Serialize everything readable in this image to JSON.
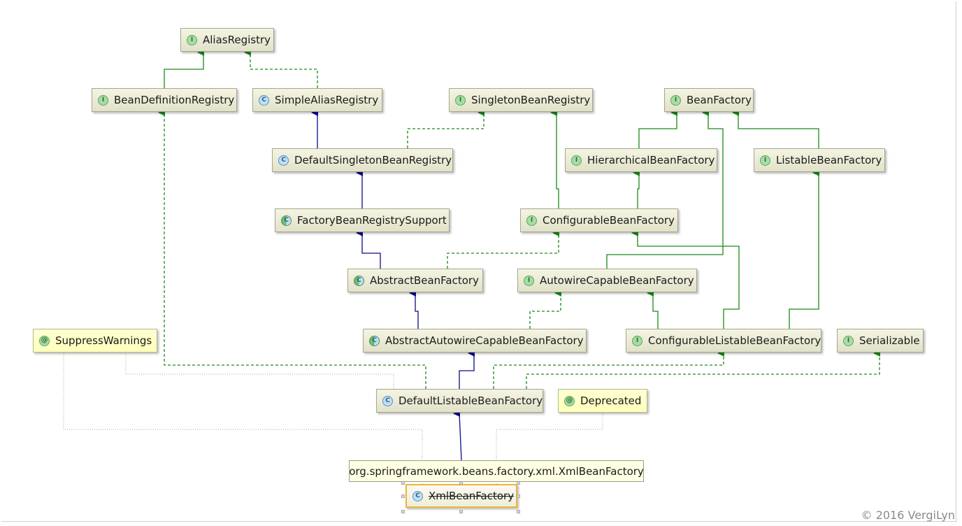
{
  "nodes": [
    {
      "id": "alias_registry",
      "label": "AliasRegistry",
      "kind": "interface",
      "icon": "interface-icon"
    },
    {
      "id": "bean_definition_registry",
      "label": "BeanDefinitionRegistry",
      "kind": "interface",
      "icon": "interface-icon"
    },
    {
      "id": "simple_alias_registry",
      "label": "SimpleAliasRegistry",
      "kind": "class",
      "icon": "class-icon"
    },
    {
      "id": "singleton_bean_registry",
      "label": "SingletonBeanRegistry",
      "kind": "interface",
      "icon": "interface-icon"
    },
    {
      "id": "bean_factory",
      "label": "BeanFactory",
      "kind": "interface",
      "icon": "interface-icon"
    },
    {
      "id": "default_singleton_bean_registry",
      "label": "DefaultSingletonBeanRegistry",
      "kind": "class",
      "icon": "class-icon"
    },
    {
      "id": "hierarchical_bean_factory",
      "label": "HierarchicalBeanFactory",
      "kind": "interface",
      "icon": "interface-icon"
    },
    {
      "id": "listable_bean_factory",
      "label": "ListableBeanFactory",
      "kind": "interface",
      "icon": "interface-icon"
    },
    {
      "id": "factory_bean_registry_support",
      "label": "FactoryBeanRegistrySupport",
      "kind": "abstract",
      "icon": "abstract-class-icon"
    },
    {
      "id": "configurable_bean_factory",
      "label": "ConfigurableBeanFactory",
      "kind": "interface",
      "icon": "interface-icon"
    },
    {
      "id": "abstract_bean_factory",
      "label": "AbstractBeanFactory",
      "kind": "abstract",
      "icon": "abstract-class-icon"
    },
    {
      "id": "autowire_capable_bean_factory",
      "label": "AutowireCapableBeanFactory",
      "kind": "interface",
      "icon": "interface-icon"
    },
    {
      "id": "suppress_warnings",
      "label": "SuppressWarnings",
      "kind": "annotation",
      "icon": "annotation-icon"
    },
    {
      "id": "abstract_autowire_capable_bean_factory",
      "label": "AbstractAutowireCapableBeanFactory",
      "kind": "abstract",
      "icon": "abstract-class-icon"
    },
    {
      "id": "configurable_listable_bean_factory",
      "label": "ConfigurableListableBeanFactory",
      "kind": "interface",
      "icon": "interface-icon"
    },
    {
      "id": "serializable",
      "label": "Serializable",
      "kind": "interface",
      "icon": "interface-icon"
    },
    {
      "id": "default_listable_bean_factory",
      "label": "DefaultListableBeanFactory",
      "kind": "class",
      "icon": "class-icon"
    },
    {
      "id": "deprecated",
      "label": "Deprecated",
      "kind": "annotation",
      "icon": "annotation-icon"
    },
    {
      "id": "xml_bean_factory",
      "label": "XmlBeanFactory",
      "kind": "class",
      "icon": "class-icon",
      "deprecated": true,
      "selected": true
    }
  ],
  "badges": {
    "interface": "I",
    "class": "C",
    "abstract": "C",
    "annotation": "@"
  },
  "tooltip": "org.springframework.beans.factory.xml.XmlBeanFactory",
  "copyright": "© 2016 VergiLyn",
  "colors": {
    "extends_class": "#0a0a8a",
    "extends_interface": "#1a8a1a",
    "implements": "#1a8a1a",
    "annotation_link": "#b8b8b8",
    "selection": "#f2b33d"
  },
  "edges": [
    {
      "from": "bean_definition_registry",
      "to": "alias_registry",
      "type": "interface-extends"
    },
    {
      "from": "simple_alias_registry",
      "to": "alias_registry",
      "type": "implements"
    },
    {
      "from": "default_singleton_bean_registry",
      "to": "simple_alias_registry",
      "type": "class-extends"
    },
    {
      "from": "default_singleton_bean_registry",
      "to": "singleton_bean_registry",
      "type": "implements"
    },
    {
      "from": "factory_bean_registry_support",
      "to": "default_singleton_bean_registry",
      "type": "class-extends"
    },
    {
      "from": "abstract_bean_factory",
      "to": "factory_bean_registry_support",
      "type": "class-extends"
    },
    {
      "from": "abstract_bean_factory",
      "to": "configurable_bean_factory",
      "type": "implements"
    },
    {
      "from": "configurable_bean_factory",
      "to": "singleton_bean_registry",
      "type": "interface-extends"
    },
    {
      "from": "configurable_bean_factory",
      "to": "hierarchical_bean_factory",
      "type": "interface-extends"
    },
    {
      "from": "hierarchical_bean_factory",
      "to": "bean_factory",
      "type": "interface-extends"
    },
    {
      "from": "listable_bean_factory",
      "to": "bean_factory",
      "type": "interface-extends"
    },
    {
      "from": "autowire_capable_bean_factory",
      "to": "bean_factory",
      "type": "interface-extends"
    },
    {
      "from": "abstract_autowire_capable_bean_factory",
      "to": "abstract_bean_factory",
      "type": "class-extends"
    },
    {
      "from": "abstract_autowire_capable_bean_factory",
      "to": "autowire_capable_bean_factory",
      "type": "implements"
    },
    {
      "from": "configurable_listable_bean_factory",
      "to": "autowire_capable_bean_factory",
      "type": "interface-extends"
    },
    {
      "from": "configurable_listable_bean_factory",
      "to": "configurable_bean_factory",
      "type": "interface-extends"
    },
    {
      "from": "configurable_listable_bean_factory",
      "to": "listable_bean_factory",
      "type": "interface-extends"
    },
    {
      "from": "default_listable_bean_factory",
      "to": "abstract_autowire_capable_bean_factory",
      "type": "class-extends"
    },
    {
      "from": "default_listable_bean_factory",
      "to": "bean_definition_registry",
      "type": "implements"
    },
    {
      "from": "default_listable_bean_factory",
      "to": "configurable_listable_bean_factory",
      "type": "implements"
    },
    {
      "from": "default_listable_bean_factory",
      "to": "serializable",
      "type": "implements"
    },
    {
      "from": "default_listable_bean_factory",
      "to": "suppress_warnings",
      "type": "annotated-with"
    },
    {
      "from": "xml_bean_factory",
      "to": "default_listable_bean_factory",
      "type": "class-extends"
    },
    {
      "from": "xml_bean_factory",
      "to": "suppress_warnings",
      "type": "annotated-with"
    },
    {
      "from": "xml_bean_factory",
      "to": "deprecated",
      "type": "annotated-with"
    }
  ]
}
